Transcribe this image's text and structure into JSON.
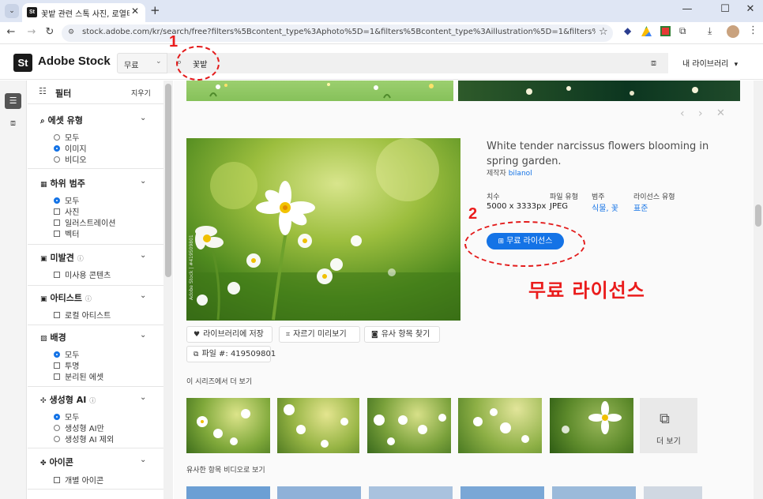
{
  "browser": {
    "tab_title": "꽃밭 관련 스톡 사진, 로열티 프",
    "tab_favicon": "St",
    "url": "stock.adobe.com/kr/search/free?filters%5Bcontent_type%3Aphoto%5D=1&filters%5Bcontent_type%3Aillustration%5D=1&filters%5Bcontent_type%3Azi..."
  },
  "header": {
    "logo_mark": "St",
    "logo_text": "Adobe Stock",
    "scope_select": "무료",
    "search_value": "꽃밭",
    "library_label": "내 라이브러리"
  },
  "annotations": {
    "marker_1": "1",
    "marker_2": "2",
    "callout": "무료 라이선스"
  },
  "filters": {
    "title": "필터",
    "clear_label": "지우기",
    "asset_type": {
      "title": "에셋 유형",
      "options": [
        "모두",
        "이미지",
        "비디오"
      ],
      "selected": "이미지"
    },
    "subcategory": {
      "title": "하위 범주",
      "options": [
        "모두",
        "사진",
        "일러스트레이션",
        "벡터"
      ],
      "selected": "모두"
    },
    "undiscovered": {
      "title": "미발견",
      "options": [
        "미사용 콘텐츠"
      ]
    },
    "artist": {
      "title": "아티스트",
      "options": [
        "로컬 아티스트"
      ]
    },
    "background": {
      "title": "배경",
      "options": [
        "모두",
        "투명",
        "분리된 에셋"
      ],
      "selected": "모두"
    },
    "generative_ai": {
      "title": "생성형 AI",
      "options": [
        "모두",
        "생성형 AI만",
        "생성형 AI 제외"
      ],
      "selected": "모두"
    },
    "icon": {
      "title": "아이콘",
      "options": [
        "개별 아이콘"
      ]
    }
  },
  "asset": {
    "title": "White tender narcissus flowers blooming in spring garden.",
    "author_prefix": "제작자",
    "author": "bilanol",
    "dimensions_label": "치수",
    "dimensions": "5000 x 3333px",
    "filetype_label": "파일 유형",
    "filetype": "JPEG",
    "category_label": "범주",
    "category": "식물, 꽃",
    "license_type_label": "라이선스 유형",
    "license_type": "표준",
    "license_button": "무료 라이선스",
    "watermark": "Adobe Stock | #419509801",
    "actions": {
      "save": "라이브러리에 저장",
      "crop": "자르기 미리보기",
      "similar": "유사 항목 찾기"
    },
    "file_number_label": "파일 #: 419509801"
  },
  "series_label": "이 시리즈에서 더 보기",
  "more_label": "더 보기",
  "similar_video_label": "유사한 항목 비디오로 보기",
  "colors": {
    "accent": "#1473e6",
    "annotation": "#ea1c1c"
  },
  "icons": [
    "back-icon",
    "forward-icon",
    "reload-icon",
    "star-icon",
    "search-icon",
    "camera-search-icon",
    "filter-icon",
    "heart-icon",
    "crop-icon",
    "similar-icon",
    "cart-icon",
    "chevron-down-icon",
    "close-icon"
  ]
}
